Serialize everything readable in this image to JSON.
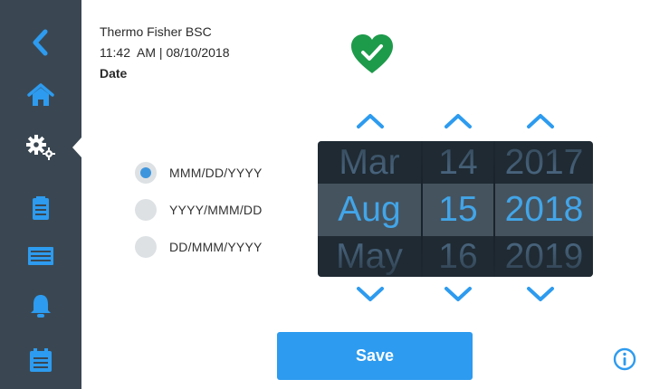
{
  "header": {
    "device_name": "Thermo Fisher BSC",
    "time": "11:42",
    "ampm": "AM",
    "separator": "|",
    "date": "08/10/2018",
    "page_title": "Date"
  },
  "status": {
    "icon": "heart-check-icon",
    "color": "#1e9a4b"
  },
  "sidebar": {
    "background": "#3a4752",
    "accent": "#2d9bef",
    "items": [
      {
        "icon": "back-arrow-icon"
      },
      {
        "icon": "home-icon"
      },
      {
        "icon": "settings-gears-icon",
        "active": true
      },
      {
        "icon": "clipboard-icon"
      },
      {
        "icon": "filter-icon"
      },
      {
        "icon": "bell-icon"
      },
      {
        "icon": "calendar-list-icon"
      }
    ]
  },
  "format_options": [
    {
      "label": "MMM/DD/YYYY",
      "selected": true
    },
    {
      "label": "YYYY/MMM/DD",
      "selected": false
    },
    {
      "label": "DD/MMM/YYYY",
      "selected": false
    }
  ],
  "picker": {
    "month": {
      "prev": "Mar",
      "current": "Aug",
      "next": "May"
    },
    "day": {
      "prev": "14",
      "current": "15",
      "next": "16"
    },
    "year": {
      "prev": "2017",
      "current": "2018",
      "next": "2019"
    }
  },
  "actions": {
    "save_label": "Save",
    "info_icon": "info-icon"
  }
}
